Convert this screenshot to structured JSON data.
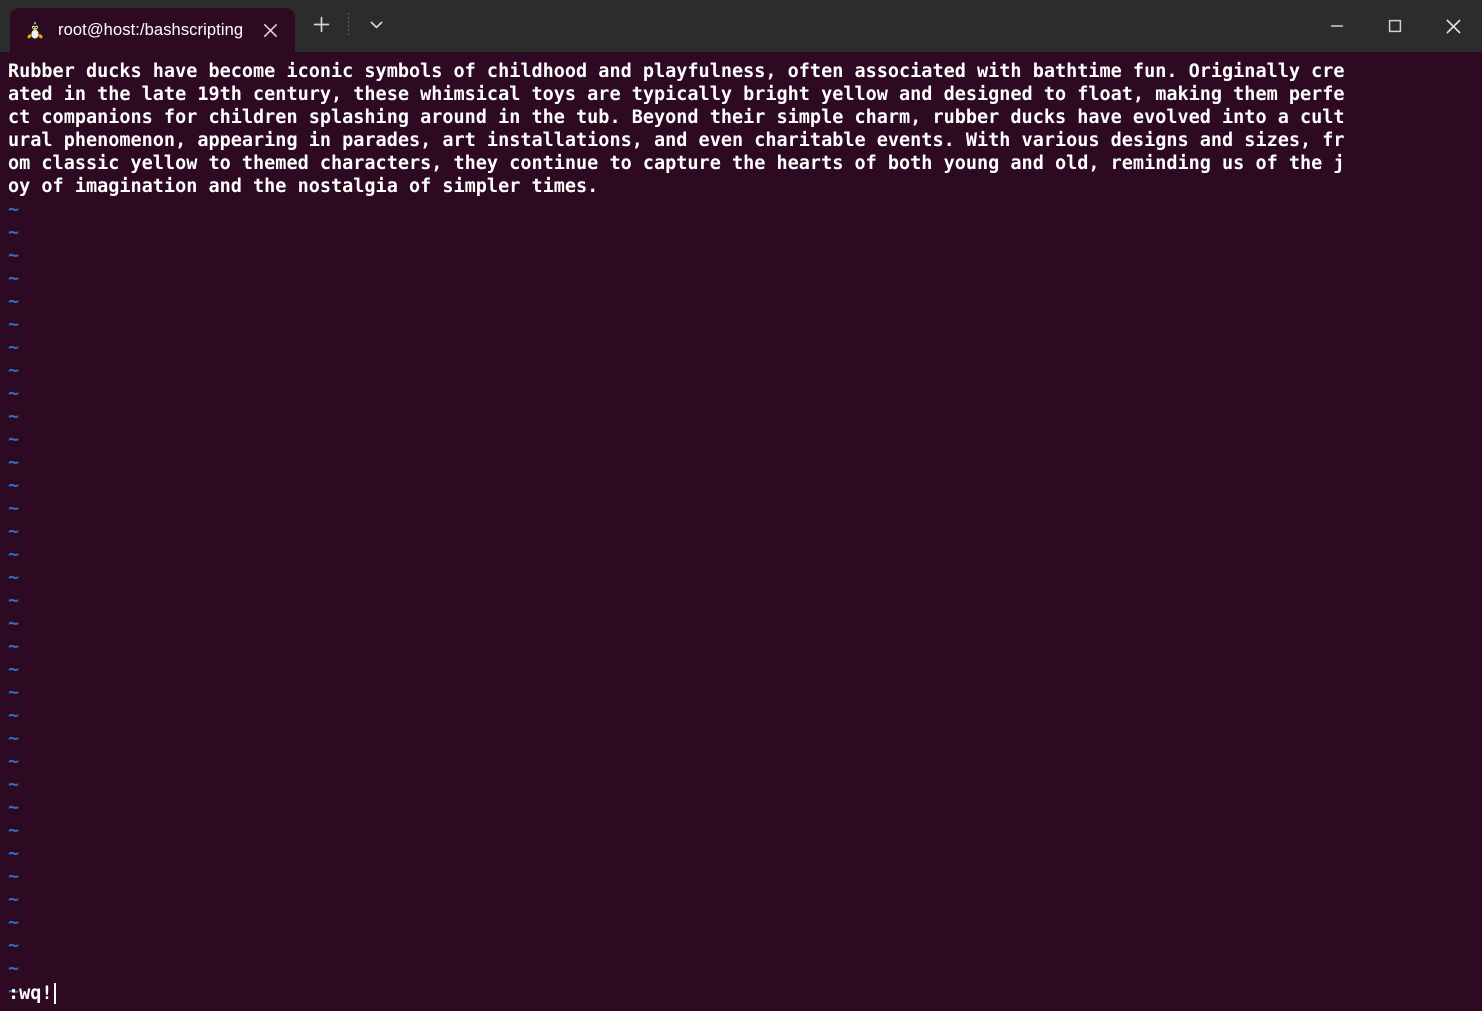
{
  "window": {
    "titlebar_color": "#2c2c2c",
    "terminal_bg": "#2d0a22",
    "terminal_fg": "#ffffff",
    "tilde_color": "#2e6fc4"
  },
  "tab": {
    "title": "root@host:/bashscripting",
    "icon": "tux-penguin-icon",
    "close_label": "✕"
  },
  "tab_tools": {
    "new_tab_label": "+",
    "tab_list_label": "⌄"
  },
  "window_controls": {
    "minimize_label": "–",
    "maximize_label": "☐",
    "close_label": "✕"
  },
  "editor": {
    "lines": [
      "Rubber ducks have become iconic symbols of childhood and playfulness, often associated with bathtime fun. Originally cre",
      "ated in the late 19th century, these whimsical toys are typically bright yellow and designed to float, making them perfe",
      "ct companions for children splashing around in the tub. Beyond their simple charm, rubber ducks have evolved into a cult",
      "ural phenomenon, appearing in parades, art installations, and even charitable events. With various designs and sizes, fr",
      "om classic yellow to themed characters, they continue to capture the hearts of both young and old, reminding us of the j",
      "oy of imagination and the nostalgia of simpler times."
    ],
    "empty_marker": "~",
    "empty_line_count": 35,
    "command_line": ":wq!"
  }
}
